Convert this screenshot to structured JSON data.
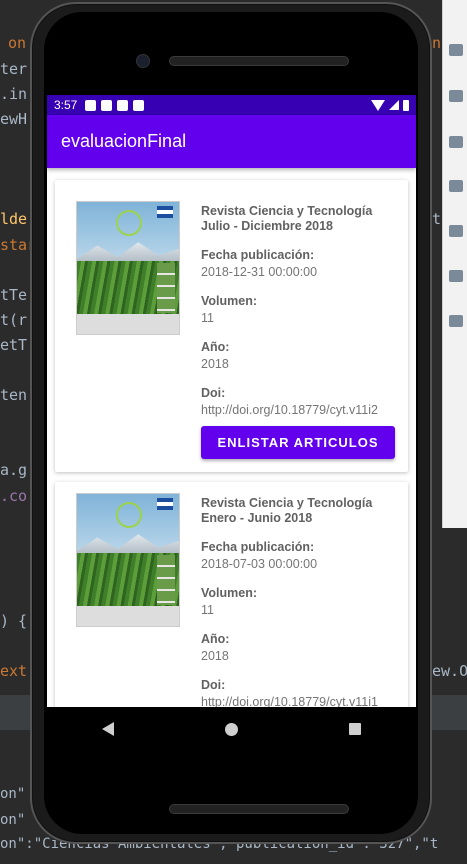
{
  "ide": {
    "left_fragments": [
      "on",
      "ter",
      ".in",
      "ewH",
      "lde",
      "star",
      "tTe",
      "t(r",
      "etT",
      "ten",
      "a.g",
      ".co",
      ") {",
      "ext"
    ],
    "right_fragments": [
      "n",
      "t",
      "ew.O"
    ],
    "bottom_lines": [
      "on\"",
      "on\"",
      "on\":\"Ciencias Ambientales\",\"publication_id\":\"327\",\"t"
    ]
  },
  "status_bar": {
    "time": "3:57"
  },
  "app_bar": {
    "title": "evaluacionFinal"
  },
  "publications": [
    {
      "title": "Revista Ciencia y Tecnología Julio - Diciembre 2018",
      "date_label": "Fecha publicación:",
      "date_value": "2018-12-31 00:00:00",
      "volume_label": "Volumen:",
      "volume_value": "11",
      "year_label": "Año:",
      "year_value": "2018",
      "doi_label": "Doi:",
      "doi_value": "http://doi.org/10.18779/cyt.v11i2",
      "button_label": "ENLISTAR ARTICULOS"
    },
    {
      "title": "Revista Ciencia y Tecnología Enero - Junio 2018",
      "date_label": "Fecha publicación:",
      "date_value": "2018-07-03 00:00:00",
      "volume_label": "Volumen:",
      "volume_value": "11",
      "year_label": "Año:",
      "year_value": "2018",
      "doi_label": "Doi:",
      "doi_value": "http://doi.org/10.18779/cyt.v11i1"
    }
  ],
  "colors": {
    "primary": "#6200ee",
    "primary_dark": "#3700b3"
  }
}
